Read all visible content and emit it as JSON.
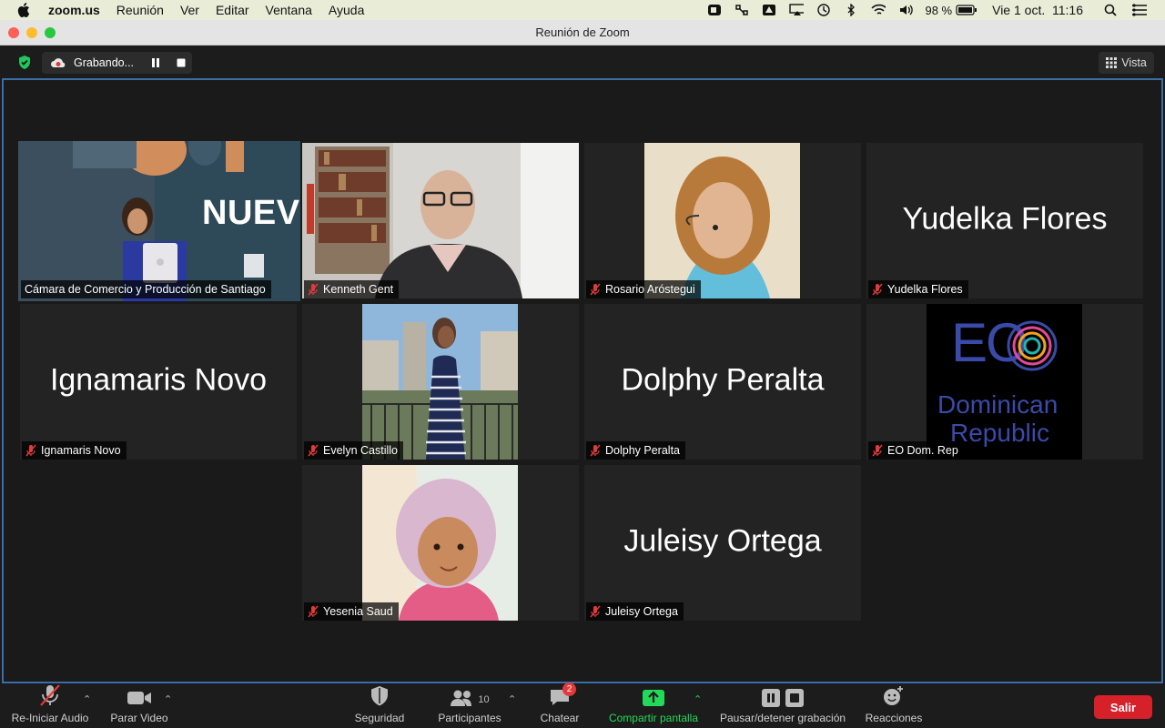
{
  "menubar": {
    "app": "zoom.us",
    "items": [
      "Reunión",
      "Ver",
      "Editar",
      "Ventana",
      "Ayuda"
    ],
    "battery": "98 %",
    "datetime": "Vie 1 oct.  11:16"
  },
  "window": {
    "title": "Reunión de Zoom"
  },
  "recording": {
    "label": "Grabando..."
  },
  "view_button": {
    "label": "Vista"
  },
  "participants": [
    {
      "name": "Cámara de Comercio y Producción de Santiago",
      "banner": "NUEV",
      "video": true,
      "active": true
    },
    {
      "name": "Kenneth Gent",
      "video": true,
      "muted": true
    },
    {
      "name": "Rosario Aróstegui",
      "video": true,
      "muted": true
    },
    {
      "name": "Yudelka Flores",
      "video": false,
      "muted": true
    },
    {
      "name": "Ignamaris Novo",
      "video": false,
      "muted": true
    },
    {
      "name": "Evelyn Castillo",
      "video": true,
      "muted": true
    },
    {
      "name": "Dolphy Peralta",
      "video": false,
      "muted": true
    },
    {
      "name": "EO Dom. Rep",
      "logo_top": "EO",
      "logo_line1": "Dominican",
      "logo_line2": "Republic",
      "muted": true
    },
    {
      "name": "Yesenia Saud",
      "video": true,
      "muted": true
    },
    {
      "name": "Juleisy Ortega",
      "video": false,
      "muted": true
    }
  ],
  "toolbar": {
    "audio": "Re-Iniciar Audio",
    "video": "Parar Video",
    "security": "Seguridad",
    "participants": "Participantes",
    "participants_count": "10",
    "chat": "Chatear",
    "chat_badge": "2",
    "share": "Compartir pantalla",
    "record": "Pausar/detener grabación",
    "reactions": "Reacciones",
    "leave": "Salir"
  },
  "colors": {
    "active_speaker": "#d8ec8e",
    "share": "#23d959",
    "leave": "#d6202a",
    "gallery_border": "#3b6ea8"
  }
}
